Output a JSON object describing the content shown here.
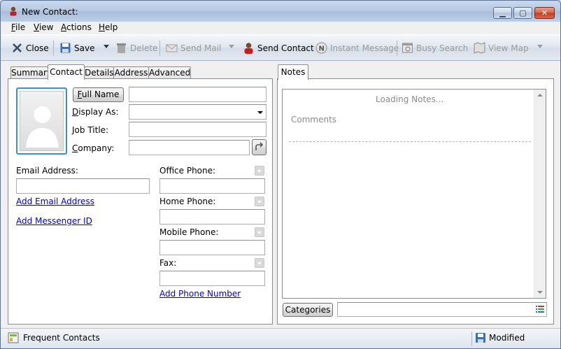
{
  "window": {
    "title": "New Contact:"
  },
  "menu": [
    {
      "label": "File",
      "accel": "F",
      "rest": "ile"
    },
    {
      "label": "View",
      "accel": "V",
      "rest": "iew"
    },
    {
      "label": "Actions",
      "accel": "A",
      "rest": "ctions"
    },
    {
      "label": "Help",
      "accel": "H",
      "rest": "elp"
    }
  ],
  "toolbar": {
    "close": "Close",
    "save": "Save",
    "delete": "Delete",
    "send_mail": "Send Mail",
    "send_contact": "Send Contact",
    "instant_message": "Instant Message",
    "busy_search": "Busy Search",
    "view_map": "View Map"
  },
  "tabs": [
    "Summary",
    "Contact",
    "Details",
    "Address",
    "Advanced"
  ],
  "active_tab": "Contact",
  "contact": {
    "full_name_btn": "Full Name",
    "full_name_accel": "F",
    "full_name_rest": "ull Name",
    "display_as_label": "Display As:",
    "display_as_accel": "D",
    "display_as_rest": "isplay As:",
    "job_title_label": "Job Title:",
    "company_label": "Company:",
    "company_accel": "C",
    "company_rest": "ompany:",
    "email_label": "Email Address:",
    "add_email": "Add Email Address",
    "add_messenger": "Add Messenger ID",
    "office_phone": "Office Phone:",
    "home_phone": "Home Phone:",
    "mobile_phone": "Mobile Phone:",
    "fax": "Fax:",
    "add_phone": "Add Phone Number"
  },
  "notes": {
    "tab": "Notes",
    "loading": "Loading Notes...",
    "comments": "Comments",
    "categories_btn": "Categories"
  },
  "status": {
    "frequent_contacts": "Frequent Contacts",
    "modified": "Modified"
  },
  "colors": {
    "link": "#0000cc",
    "accent": "#3c8fd1",
    "disabled": "#9a9a9a"
  }
}
